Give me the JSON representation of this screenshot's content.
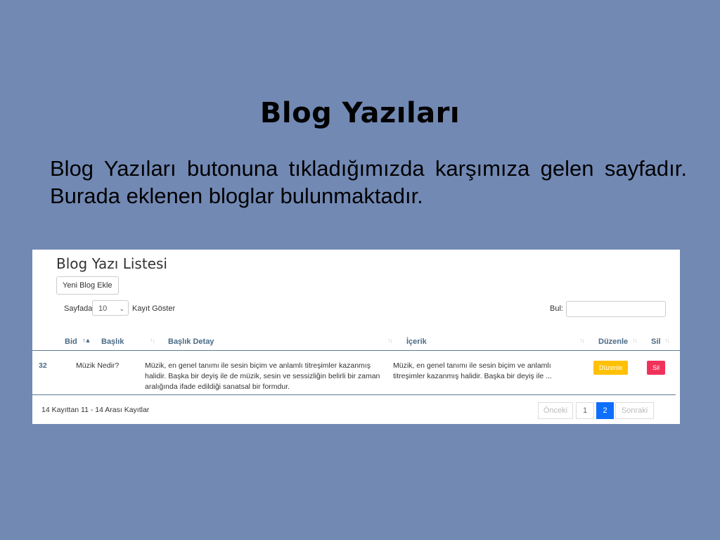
{
  "slide": {
    "title": "Blog Yazıları",
    "description": "Blog Yazıları butonuna tıkladığımızda karşımıza gelen sayfadır. Burada eklenen bloglar bulunmaktadır."
  },
  "panel": {
    "title": "Blog Yazı Listesi",
    "new_button": "Yeni Blog Ekle",
    "length_prefix": "Sayfada",
    "length_value": "10",
    "length_suffix": "Kayıt Göster",
    "search_label": "Bul:",
    "search_value": "",
    "columns": [
      "Bid",
      "Başlık",
      "Başlık Detay",
      "İçerik",
      "Düzenle",
      "Sil"
    ],
    "rows": [
      {
        "bid": "32",
        "baslik": "Müzik Nedir?",
        "detay": "Müzik, en genel tanımı ile sesin biçim ve anlamlı titreşimler kazanmış halidir. Başka bir deyiş ile de müzik, sesin ve sessizliğin belirli bir zaman aralığında ifade edildiği sanatsal bir formdur.",
        "icerik": "Müzik, en genel tanımı ile sesin biçim ve anlamlı titreşimler kazanmış halidir. Başka bir deyiş ile ...",
        "edit_label": "Düzenle",
        "delete_label": "Sil"
      }
    ],
    "info": "14 Kayıttan 11 - 14 Arası Kayıtlar",
    "pagination": {
      "prev": "Önceki",
      "pages": [
        "1",
        "2"
      ],
      "current": "2",
      "next": "Sonraki"
    }
  },
  "colors": {
    "background": "#7289b4",
    "edit_button": "#ffc107",
    "delete_button": "#f0325a",
    "active_page": "#0d6efd",
    "header_text": "#4a6a86"
  },
  "icons": {
    "sort_active": "sort-asc-icon",
    "sort": "sort-icon",
    "select": "chevron-down-icon"
  }
}
